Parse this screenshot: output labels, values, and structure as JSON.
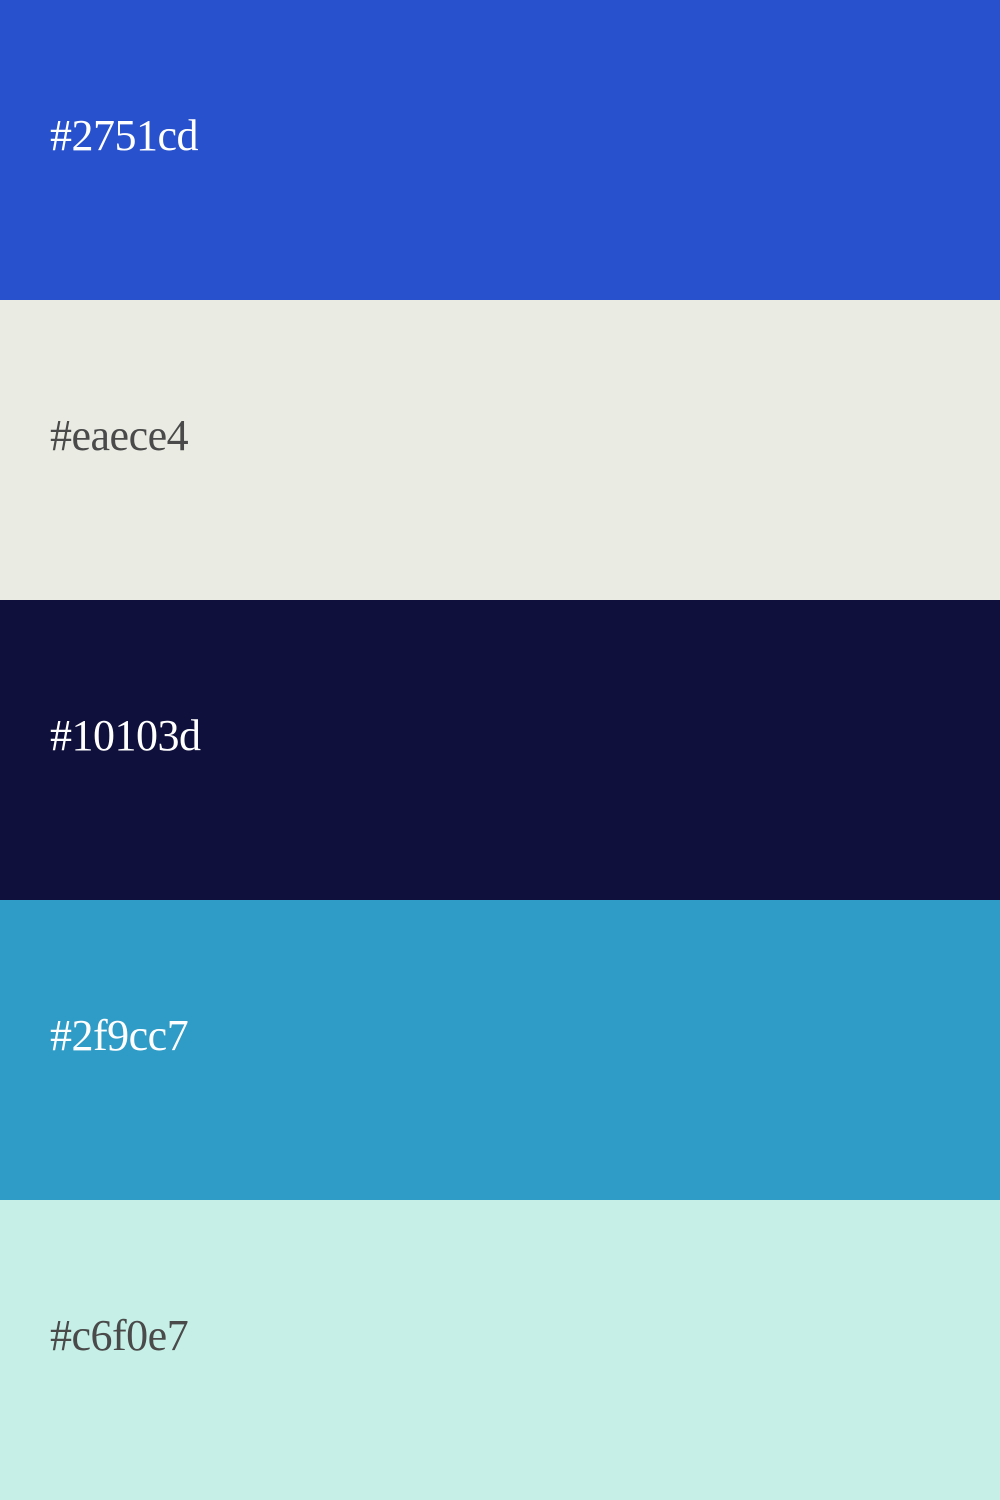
{
  "swatches": [
    {
      "label": "#2751cd",
      "color": "#2751cd",
      "text_color": "#ffffff"
    },
    {
      "label": "#eaece4",
      "color": "#eaece4",
      "text_color": "#4a4a4a"
    },
    {
      "label": "#10103d",
      "color": "#10103d",
      "text_color": "#ffffff"
    },
    {
      "label": "#2f9cc7",
      "color": "#2f9cc7",
      "text_color": "#ffffff"
    },
    {
      "label": "#c6f0e7",
      "color": "#c6f0e7",
      "text_color": "#4a4a4a"
    }
  ]
}
